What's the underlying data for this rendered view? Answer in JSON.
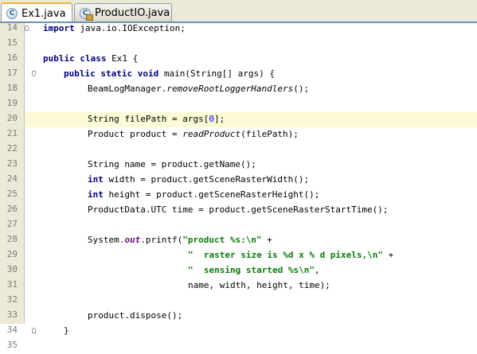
{
  "tabs": [
    {
      "label": "Ex1.java",
      "icon": "java-class-icon",
      "active": true
    },
    {
      "label": "ProductIO.java",
      "icon": "java-class-readonly-icon",
      "active": false
    }
  ],
  "colors": {
    "active_tab_accent": "#f2b233",
    "current_line": "#fdfbd6",
    "keyword": "#000080",
    "string": "#0a7a0a"
  },
  "current_line": 20,
  "lines": [
    {
      "num": "14",
      "indent": 0,
      "fold": "end",
      "segs": [
        {
          "t": "import",
          "c": "kw"
        },
        {
          "t": " java.io.IOException;"
        }
      ]
    },
    {
      "num": "15",
      "indent": 0,
      "segs": []
    },
    {
      "num": "16",
      "indent": 0,
      "segs": [
        {
          "t": "public",
          "c": "kw"
        },
        {
          "t": " "
        },
        {
          "t": "class",
          "c": "kw"
        },
        {
          "t": " Ex1 {"
        }
      ]
    },
    {
      "num": "17",
      "indent": 1,
      "fold": "open",
      "segs": [
        {
          "t": "public",
          "c": "kw"
        },
        {
          "t": " "
        },
        {
          "t": "static",
          "c": "kw"
        },
        {
          "t": " "
        },
        {
          "t": "void",
          "c": "kw"
        },
        {
          "t": " main(String[] args) {"
        }
      ]
    },
    {
      "num": "18",
      "indent": 2,
      "segs": [
        {
          "t": "BeamLogManager."
        },
        {
          "t": "removeRootLoggerHandlers",
          "c": "it"
        },
        {
          "t": "();"
        }
      ]
    },
    {
      "num": "19",
      "indent": 0,
      "segs": []
    },
    {
      "num": "20",
      "indent": 2,
      "segs": [
        {
          "t": "String filePath = args["
        },
        {
          "t": "0",
          "c": "num"
        },
        {
          "t": "];"
        }
      ]
    },
    {
      "num": "21",
      "indent": 2,
      "segs": [
        {
          "t": "Product product = "
        },
        {
          "t": "readProduct",
          "c": "it"
        },
        {
          "t": "(filePath);"
        }
      ]
    },
    {
      "num": "22",
      "indent": 0,
      "segs": []
    },
    {
      "num": "23",
      "indent": 2,
      "segs": [
        {
          "t": "String name = product.getName();"
        }
      ]
    },
    {
      "num": "24",
      "indent": 2,
      "segs": [
        {
          "t": "int",
          "c": "kw"
        },
        {
          "t": " width = product.getSceneRasterWidth();"
        }
      ]
    },
    {
      "num": "25",
      "indent": 2,
      "segs": [
        {
          "t": "int",
          "c": "kw"
        },
        {
          "t": " height = product.getSceneRasterHeight();"
        }
      ]
    },
    {
      "num": "26",
      "indent": 2,
      "segs": [
        {
          "t": "ProductData.UTC time = product.getSceneRasterStartTime();"
        }
      ]
    },
    {
      "num": "27",
      "indent": 0,
      "segs": []
    },
    {
      "num": "28",
      "indent": 2,
      "segs": [
        {
          "t": "System."
        },
        {
          "t": "out",
          "c": "fld"
        },
        {
          "t": ".printf("
        },
        {
          "t": "\"product %s:\\n\"",
          "c": "str"
        },
        {
          "t": " +"
        }
      ]
    },
    {
      "num": "29",
      "indent": 3,
      "segs": [
        {
          "t": "\"  raster size is %d x % d pixels,\\n\"",
          "c": "str"
        },
        {
          "t": " +"
        }
      ]
    },
    {
      "num": "30",
      "indent": 3,
      "segs": [
        {
          "t": "\"  sensing started %s\\n\"",
          "c": "str"
        },
        {
          "t": ","
        }
      ]
    },
    {
      "num": "31",
      "indent": 3,
      "segs": [
        {
          "t": "name, width, height, time);"
        }
      ]
    },
    {
      "num": "32",
      "indent": 0,
      "segs": []
    },
    {
      "num": "33",
      "indent": 2,
      "segs": [
        {
          "t": "product.dispose();"
        }
      ]
    },
    {
      "num": "34",
      "indent": 1,
      "fold": "end",
      "segs": [
        {
          "t": "}"
        }
      ]
    },
    {
      "num": "35",
      "indent": 0,
      "segs": []
    }
  ]
}
